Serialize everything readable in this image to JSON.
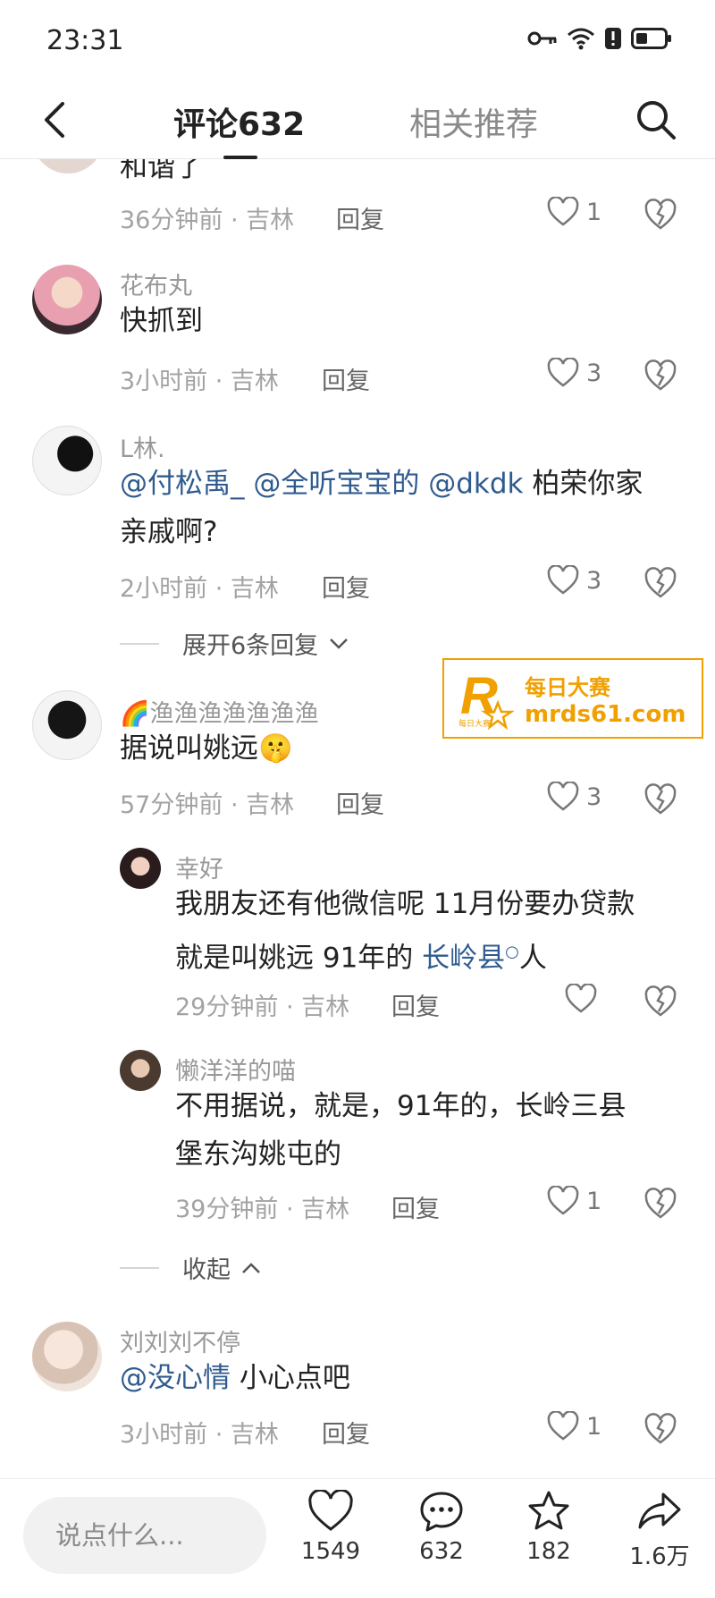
{
  "status_bar": {
    "time": "23:31"
  },
  "header": {
    "tab_comments": "评论632",
    "tab_related": "相关推荐"
  },
  "comments": [
    {
      "text_partial": "和谐了",
      "time_location": "36分钟前 · 吉林",
      "reply": "回复",
      "likes": "1"
    },
    {
      "name": "花布丸",
      "text": "快抓到",
      "time_location": "3小时前 · 吉林",
      "reply": "回复",
      "likes": "3"
    },
    {
      "name": "L林.",
      "mention1": "@付松禹_",
      "mention2": "@全听宝宝的",
      "mention3": "@dkdk",
      "text_after": " 柏荣你家",
      "text_line2": "亲戚啊?",
      "time_location": "2小时前 · 吉林",
      "reply": "回复",
      "likes": "3",
      "expand": "展开6条回复"
    },
    {
      "name": "渔渔渔渔渔渔渔",
      "text": "据说叫姚远",
      "time_location": "57分钟前 · 吉林",
      "reply": "回复",
      "likes": "3",
      "replies": [
        {
          "name": "幸好",
          "text_line1": "我朋友还有他微信呢 11月份要办贷款",
          "text_line2_before": "就是叫姚远 91年的 ",
          "text_line2_link": "长岭县",
          "text_line2_after": "人",
          "time_location": "29分钟前 · 吉林",
          "reply": "回复"
        },
        {
          "name": "懒洋洋的喵",
          "text_line1": "不用据说，就是，91年的，长岭三县",
          "text_line2": "堡东沟姚屯的",
          "time_location": "39分钟前 · 吉林",
          "reply": "回复",
          "likes": "1"
        }
      ],
      "collapse": "收起"
    },
    {
      "name": "刘刘刘不停",
      "mention": "@没心情",
      "text_after": " 小心点吧",
      "time_location": "3小时前 · 吉林",
      "reply": "回复",
      "likes": "1"
    }
  ],
  "watermark": {
    "line1": "每日大赛",
    "line2": "mrds61.com",
    "logo_letter": "R",
    "logo_small": "每日大赛"
  },
  "bottom_bar": {
    "input_placeholder": "说点什么...",
    "like_count": "1549",
    "comment_count": "632",
    "favorite_count": "182",
    "share_count": "1.6万"
  },
  "colors": {
    "mention": "#2f5b8f",
    "watermark": "#f0a000",
    "muted": "#a3a3a3"
  }
}
